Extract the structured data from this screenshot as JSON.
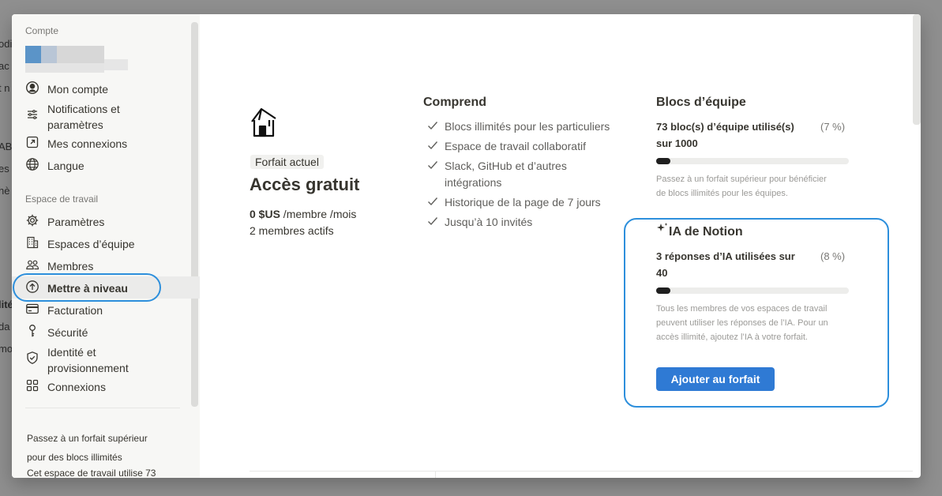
{
  "background_fragments": [
    "odi",
    "ac",
    "t n",
    "AB",
    "es V",
    "hè",
    "lité",
    "da",
    "mo"
  ],
  "sidebar": {
    "account_section": "Compte",
    "account_items": [
      {
        "label": "Mon compte",
        "icon": "user-circle-icon"
      },
      {
        "label": "Notifications et paramètres",
        "icon": "sliders-icon"
      },
      {
        "label": "Mes connexions",
        "icon": "external-link-icon"
      },
      {
        "label": "Langue",
        "icon": "globe-icon"
      }
    ],
    "workspace_section": "Espace de travail",
    "workspace_items": [
      {
        "label": "Paramètres",
        "icon": "gear-icon"
      },
      {
        "label": "Espaces d’équipe",
        "icon": "building-icon"
      },
      {
        "label": "Membres",
        "icon": "people-icon"
      },
      {
        "label": "Mettre à niveau",
        "icon": "arrow-up-circle-icon",
        "active": true
      },
      {
        "label": "Facturation",
        "icon": "credit-card-icon"
      },
      {
        "label": "Sécurité",
        "icon": "key-icon"
      },
      {
        "label": "Identité et provisionnement",
        "icon": "shield-check-icon"
      },
      {
        "label": "Connexions",
        "icon": "grid-icon"
      }
    ],
    "promo_title_1": "Passez à un forfait supérieur",
    "promo_title_2": "pour des blocs illimités",
    "promo_text": "Cet espace de travail utilise 73"
  },
  "plan": {
    "tag": "Forfait actuel",
    "name": "Accès gratuit",
    "price_amount": "0 $US",
    "price_unit": " /membre /mois",
    "members": "2 membres actifs"
  },
  "includes": {
    "title": "Comprend",
    "items": [
      "Blocs illimités pour les particuliers",
      "Espace de travail collaboratif",
      "Slack, GitHub et d’autres intégrations",
      "Historique de la page de 7 jours",
      "Jusqu’à 10 invités"
    ]
  },
  "team_blocks": {
    "title": "Blocs d’équipe",
    "usage_line1": "73 bloc(s) d’équipe utilisé(s)",
    "usage_line2": "sur 1000",
    "percent": "(7 %)",
    "progress": 0.073,
    "note": "Passez à un forfait supérieur pour bénéficier de blocs illimités pour les équipes."
  },
  "ai": {
    "title": "IA de Notion",
    "usage_line1": "3 réponses d’IA utilisées sur",
    "usage_line2": "40",
    "percent": "(8 %)",
    "progress": 0.075,
    "note": "Tous les membres de vos espaces de travail peuvent utiliser les réponses de l’IA. Pour un accès illimité, ajoutez l’IA à votre forfait.",
    "button": "Ajouter au forfait"
  },
  "colors": {
    "accent": "#2f7ad4",
    "highlight_ring": "#2d8fdc",
    "sidebar_bg": "#f7f7f5"
  }
}
